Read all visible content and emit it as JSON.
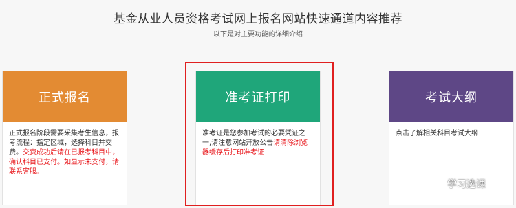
{
  "header": {
    "title": "基金从业人员资格考试网上报名网站快速通道内容推荐",
    "subtitle": "以下是对主要功能的详细介绍"
  },
  "cards": [
    {
      "title": "正式报名",
      "color": "#e38b33",
      "body_black": "正式报名阶段需要采集考生信息，报考流程：指定区域，选择科目并交费。",
      "body_red": "交费成功后请在已报考科目中，确认科目已支付。如显示未支付，请联系客服。"
    },
    {
      "title": "准考证打印",
      "color": "#1fa67a",
      "body_black": "准考证是您参加考试的必要凭证之一,请注意网站开放公告",
      "body_red": "请清除浏览器缓存后打印准考证"
    },
    {
      "title": "考试大纲",
      "color": "#5e4786",
      "body_black": "点击了解相关科目考试大纲",
      "body_red": ""
    }
  ],
  "highlight_color": "#e02020",
  "watermark": {
    "icon": "wechat-icon",
    "text": "学习选课"
  }
}
